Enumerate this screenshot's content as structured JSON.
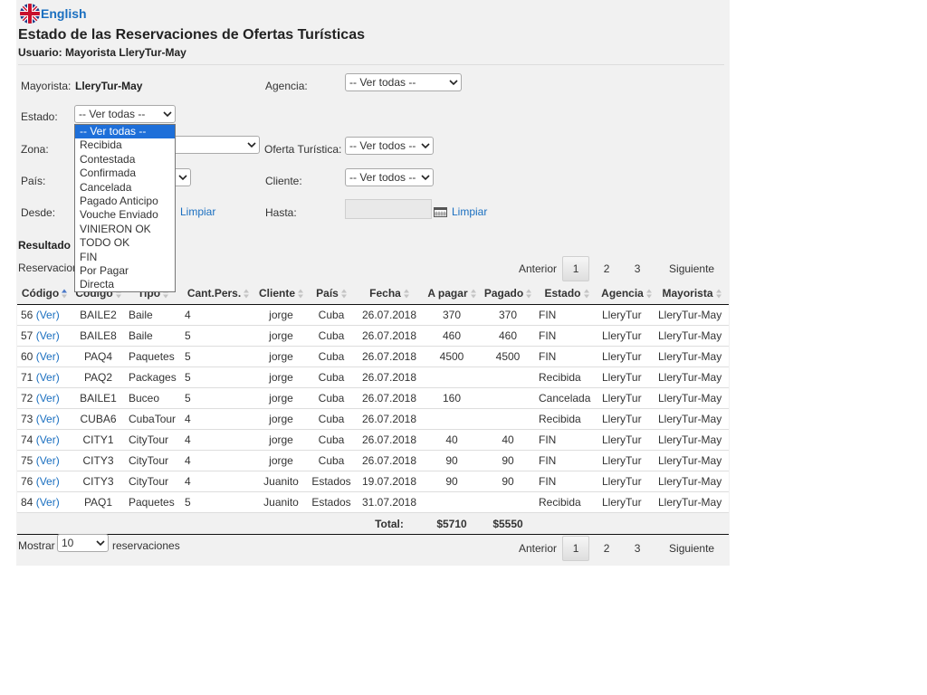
{
  "language": {
    "label": "English",
    "icon": "uk-flag-icon"
  },
  "header": {
    "title": "Estado de las Reservaciones de Ofertas Turísticas",
    "user_line": "Usuario: Mayorista LleryTur-May"
  },
  "filters": {
    "mayorista_label": "Mayorista:",
    "mayorista_value": "LleryTur-May",
    "agencia_label": "Agencia:",
    "agencia_value": "-- Ver todas --",
    "estado_label": "Estado:",
    "estado_value": "-- Ver todas --",
    "zona_label": "Zona:",
    "oferta_label": "Oferta Turística:",
    "oferta_value": "-- Ver todos --",
    "pais_label": "País:",
    "cliente_label": "Cliente:",
    "cliente_value": "-- Ver todos --",
    "desde_label": "Desde:",
    "hasta_label": "Hasta:",
    "limpiar_label": "Limpiar"
  },
  "estado_dropdown": {
    "options": [
      "-- Ver todas --",
      "Recibida",
      "Contestada",
      "Confirmada",
      "Cancelada",
      "Pagado Anticipo",
      "Vouche Enviado",
      "VINIERON OK",
      "TODO OK",
      "FIN",
      "Por Pagar",
      "Directa"
    ],
    "selected_index": 0
  },
  "results": {
    "heading": "Resultado",
    "count_text": "Reservacion"
  },
  "pager": {
    "prev": "Anterior",
    "next": "Siguiente",
    "pages": [
      "1",
      "2",
      "3"
    ],
    "current": "1"
  },
  "table": {
    "columns": [
      "Código",
      "Código",
      "Tipo",
      "Cant.Pers.",
      "Cliente",
      "País",
      "Fecha",
      "A pagar",
      "Pagado",
      "Estado",
      "Agencia",
      "Mayorista"
    ],
    "ver_link": "(Ver)",
    "rows": [
      [
        "56",
        "BAILE2",
        "Baile",
        "4",
        "jorge",
        "Cuba",
        "26.07.2018",
        "370",
        "370",
        "FIN",
        "LleryTur",
        "LleryTur-May"
      ],
      [
        "57",
        "BAILE8",
        "Baile",
        "5",
        "jorge",
        "Cuba",
        "26.07.2018",
        "460",
        "460",
        "FIN",
        "LleryTur",
        "LleryTur-May"
      ],
      [
        "60",
        "PAQ4",
        "Paquetes",
        "5",
        "jorge",
        "Cuba",
        "26.07.2018",
        "4500",
        "4500",
        "FIN",
        "LleryTur",
        "LleryTur-May"
      ],
      [
        "71",
        "PAQ2",
        "Packages",
        "5",
        "jorge",
        "Cuba",
        "26.07.2018",
        "",
        "",
        "Recibida",
        "LleryTur",
        "LleryTur-May"
      ],
      [
        "72",
        "BAILE1",
        "Buceo",
        "5",
        "jorge",
        "Cuba",
        "26.07.2018",
        "160",
        "",
        "Cancelada",
        "LleryTur",
        "LleryTur-May"
      ],
      [
        "73",
        "CUBA6",
        "CubaTour",
        "4",
        "jorge",
        "Cuba",
        "26.07.2018",
        "",
        "",
        "Recibida",
        "LleryTur",
        "LleryTur-May"
      ],
      [
        "74",
        "CITY1",
        "CityTour",
        "4",
        "jorge",
        "Cuba",
        "26.07.2018",
        "40",
        "40",
        "FIN",
        "LleryTur",
        "LleryTur-May"
      ],
      [
        "75",
        "CITY3",
        "CityTour",
        "4",
        "jorge",
        "Cuba",
        "26.07.2018",
        "90",
        "90",
        "FIN",
        "LleryTur",
        "LleryTur-May"
      ],
      [
        "76",
        "CITY3",
        "CityTour",
        "4",
        "Juanito",
        "Estados",
        "19.07.2018",
        "90",
        "90",
        "FIN",
        "LleryTur",
        "LleryTur-May"
      ],
      [
        "84",
        "PAQ1",
        "Paquetes",
        "5",
        "Juanito",
        "Estados",
        "31.07.2018",
        "",
        "",
        "Recibida",
        "LleryTur",
        "LleryTur-May"
      ]
    ],
    "total_label": "Total:",
    "total_apagar": "$5710",
    "total_pagado": "$5550"
  },
  "footer": {
    "mostrar_label": "Mostrar",
    "mostrar_value": "10",
    "reservaciones_label": "reservaciones"
  },
  "colors": {
    "link": "#1a6fc0",
    "panel_bg": "#f1f1f1",
    "selected_option": "#1e6fd9"
  }
}
